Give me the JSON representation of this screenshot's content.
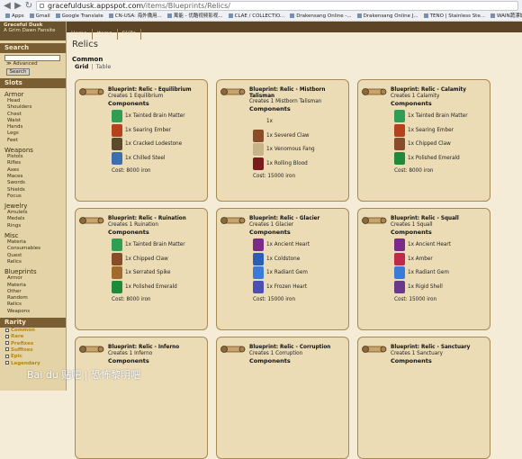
{
  "browser": {
    "address_domain": "gracefuldusk.appspot.com",
    "address_path": "/items/Blueprints/Relics/",
    "bookmarks": [
      "Apps",
      "Gmail",
      "Google Translate",
      "CN-USA: 海外僑用...",
      "萬能 - 优酷视频影视...",
      "CLAE / COLLECTIO...",
      "Drakensang Online -...",
      "Drakensang Online J...",
      "TENO | Stainless Ste...",
      "WAIN蔬漂城 - ..."
    ]
  },
  "sidebar": {
    "logo_line1": "Graceful Dusk",
    "logo_line2": "A Grim Dawn Fansite",
    "search_title": "Search",
    "advanced": "≫ Advanced",
    "search_button": "Search",
    "slots_title": "Slots",
    "groups": [
      {
        "name": "Armor",
        "items": [
          "Head",
          "Shoulders",
          "Chest",
          "Waist",
          "Hands",
          "Legs",
          "Feet"
        ]
      },
      {
        "name": "Weapons",
        "items": [
          "Pistols",
          "Rifles",
          "Axes",
          "Maces",
          "Swords",
          "Shields",
          "Focus"
        ]
      },
      {
        "name": "Jewelry",
        "items": [
          "Amulets",
          "Medals",
          "Rings"
        ]
      },
      {
        "name": "Misc",
        "items": [
          "Materia",
          "Consumables",
          "Quest",
          "Relics"
        ]
      },
      {
        "name": "Blueprints",
        "items": [
          "Armor",
          "Materia",
          "Other",
          "Random",
          "Relics",
          "Weapons"
        ]
      }
    ],
    "rarity_title": "Rarity",
    "rarities": [
      {
        "label": "Common",
        "color": "#b8860b"
      },
      {
        "label": "Rare",
        "color": "#b8860b"
      },
      {
        "label": "Prefixes",
        "color": "#b8860b"
      },
      {
        "label": "Suffixes",
        "color": "#b8860b"
      },
      {
        "label": "Epic",
        "color": "#b8860b"
      },
      {
        "label": "Legendary",
        "color": "#b8860b"
      }
    ]
  },
  "topnav": [
    "Home",
    "Items",
    "Skills"
  ],
  "main": {
    "title": "Relics",
    "section": "Common",
    "view_grid": "Grid",
    "view_table": "Table",
    "components_label": "Components"
  },
  "cards": [
    {
      "title": "Blueprint: Relic - Equilibrium",
      "creates": "Creates 1 Equilibrium",
      "components": [
        {
          "text": "1x Tainted Brain Matter",
          "icon": "brain-matter-icon",
          "color": "#2f9e55"
        },
        {
          "text": "1x Searing Ember",
          "icon": "ember-icon",
          "color": "#b5421d"
        },
        {
          "text": "1x Cracked Lodestone",
          "icon": "lodestone-icon",
          "color": "#5b4a2c"
        },
        {
          "text": "1x Chilled Steel",
          "icon": "steel-icon",
          "color": "#3d6fb0"
        }
      ],
      "cost": "Cost: 8000 iron"
    },
    {
      "title": "Blueprint: Relic - Mistborn Talisman",
      "creates": "Creates 1 Mistborn Talisman",
      "components": [
        {
          "text": "1x",
          "icon": "empty-slot-icon",
          "color": "#ecdcb6"
        },
        {
          "text": "1x Severed Claw",
          "icon": "claw-icon",
          "color": "#8a4d2a"
        },
        {
          "text": "1x Venomous Fang",
          "icon": "fang-icon",
          "color": "#c9b48a"
        },
        {
          "text": "1x Rolling Blood",
          "icon": "blood-icon",
          "color": "#7a1c1c"
        }
      ],
      "cost": "Cost: 15000 iron"
    },
    {
      "title": "Blueprint: Relic - Calamity",
      "creates": "Creates 1 Calamity",
      "components": [
        {
          "text": "1x Tainted Brain Matter",
          "icon": "brain-matter-icon",
          "color": "#2f9e55"
        },
        {
          "text": "1x Searing Ember",
          "icon": "ember-icon",
          "color": "#b5421d"
        },
        {
          "text": "1x Chipped Claw",
          "icon": "claw-icon",
          "color": "#8a4d2a"
        },
        {
          "text": "1x Polished Emerald",
          "icon": "emerald-icon",
          "color": "#1f8a3a"
        }
      ],
      "cost": "Cost: 8000 iron"
    },
    {
      "title": "Blueprint: Relic - Ruination",
      "creates": "Creates 1 Ruination",
      "components": [
        {
          "text": "1x Tainted Brain Matter",
          "icon": "brain-matter-icon",
          "color": "#2f9e55"
        },
        {
          "text": "1x Chipped Claw",
          "icon": "claw-icon",
          "color": "#8a4d2a"
        },
        {
          "text": "1x Serrated Spike",
          "icon": "spike-icon",
          "color": "#a06a2b"
        },
        {
          "text": "1x Polished Emerald",
          "icon": "emerald-icon",
          "color": "#1f8a3a"
        }
      ],
      "cost": "Cost: 8000 iron"
    },
    {
      "title": "Blueprint: Relic - Glacier",
      "creates": "Creates 1 Glacier",
      "components": [
        {
          "text": "1x Ancient Heart",
          "icon": "heart-icon",
          "color": "#7b2a8a"
        },
        {
          "text": "1x Coldstone",
          "icon": "coldstone-icon",
          "color": "#2a5fb5"
        },
        {
          "text": "1x Radiant Gem",
          "icon": "gem-icon",
          "color": "#3a7bd5"
        },
        {
          "text": "1x Frozen Heart",
          "icon": "frozen-heart-icon",
          "color": "#4a4fb0"
        }
      ],
      "cost": "Cost: 15000 iron"
    },
    {
      "title": "Blueprint: Relic - Squall",
      "creates": "Creates 1 Squall",
      "components": [
        {
          "text": "1x Ancient Heart",
          "icon": "heart-icon",
          "color": "#7b2a8a"
        },
        {
          "text": "1x Amber",
          "icon": "amber-icon",
          "color": "#c02a4a"
        },
        {
          "text": "1x Radiant Gem",
          "icon": "gem-icon",
          "color": "#3a7bd5"
        },
        {
          "text": "1x Rigid Shell",
          "icon": "shell-icon",
          "color": "#6a3a8a"
        }
      ],
      "cost": "Cost: 15000 iron"
    },
    {
      "title": "Blueprint: Relic - Inferno",
      "creates": "Creates 1 Inferno",
      "components": [],
      "cost": ""
    },
    {
      "title": "Blueprint: Relic - Corruption",
      "creates": "Creates 1 Corruption",
      "components": [],
      "cost": ""
    },
    {
      "title": "Blueprint: Relic - Sanctuary",
      "creates": "Creates 1 Sanctuary",
      "components": [],
      "cost": ""
    }
  ],
  "watermark": "Bai du 贴吧 | 恐怖黎明吧"
}
